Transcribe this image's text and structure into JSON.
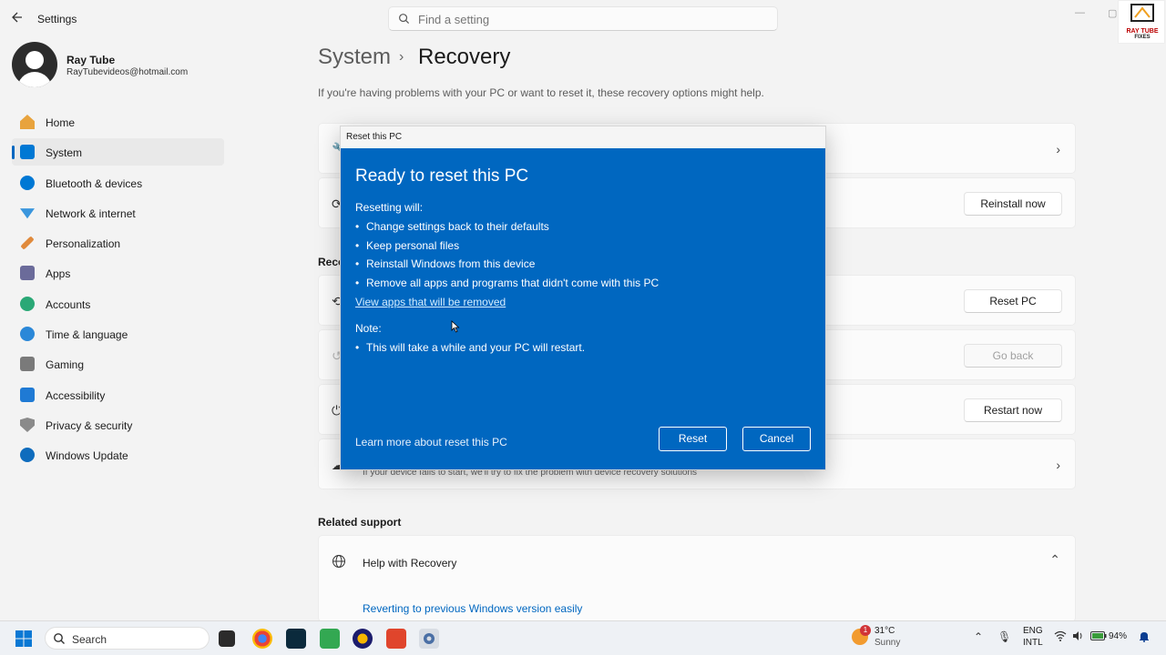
{
  "window": {
    "title": "Settings",
    "search_placeholder": "Find a setting"
  },
  "logo": {
    "line1": "RAY TUBE",
    "line2": "FIXES"
  },
  "profile": {
    "name": "Ray Tube",
    "email": "RayTubevideos@hotmail.com"
  },
  "nav": {
    "items": [
      {
        "label": "Home",
        "icon": "home-icon",
        "color": "#e8a33d"
      },
      {
        "label": "System",
        "icon": "system-icon",
        "color": "#0078d4",
        "active": true
      },
      {
        "label": "Bluetooth & devices",
        "icon": "bluetooth-icon",
        "color": "#0078d4"
      },
      {
        "label": "Network & internet",
        "icon": "network-icon",
        "color": "#3a96dd"
      },
      {
        "label": "Personalization",
        "icon": "brush-icon",
        "color": "#e08a3c"
      },
      {
        "label": "Apps",
        "icon": "apps-icon",
        "color": "#6b6b9a"
      },
      {
        "label": "Accounts",
        "icon": "accounts-icon",
        "color": "#2aa876"
      },
      {
        "label": "Time & language",
        "icon": "time-language-icon",
        "color": "#2b88d8"
      },
      {
        "label": "Gaming",
        "icon": "gaming-icon",
        "color": "#7a7a7a"
      },
      {
        "label": "Accessibility",
        "icon": "accessibility-icon",
        "color": "#1f7ad4"
      },
      {
        "label": "Privacy & security",
        "icon": "shield-icon",
        "color": "#8a8a8a"
      },
      {
        "label": "Windows Update",
        "icon": "update-icon",
        "color": "#0f6cbd"
      }
    ]
  },
  "header": {
    "parent": "System",
    "separator": "›",
    "title": "Recovery"
  },
  "subtitle": "If you're having problems with your PC or want to reset it, these recovery options might help.",
  "cards": {
    "reinstall_button": "Reinstall now",
    "section_label": "Reco",
    "reset_button": "Reset PC",
    "goback_button": "Go back",
    "restart_button": "Restart now",
    "recovery_sub": "If your device fails to start, we'll try to fix the problem with device recovery solutions"
  },
  "related": {
    "label": "Related support",
    "help_title": "Help with Recovery",
    "help_link": "Reverting to previous Windows version easily"
  },
  "dialog": {
    "window_title": "Reset this PC",
    "heading": "Ready to reset this PC",
    "resetting_will": "Resetting will:",
    "bullets": [
      "Change settings back to their defaults",
      "Keep personal files",
      "Reinstall Windows from this device",
      "Remove all apps and programs that didn't come with this PC"
    ],
    "view_apps_link": "View apps that will be removed",
    "note_label": "Note:",
    "note_bullet": "This will take a while and your PC will restart.",
    "learn_more": "Learn more about reset this PC",
    "reset_button": "Reset",
    "cancel_button": "Cancel",
    "bullet_char": "•"
  },
  "taskbar": {
    "search_label": "Search",
    "weather": {
      "badge": "1",
      "temp": "31°C",
      "condition": "Sunny"
    },
    "lang_line1": "ENG",
    "lang_line2": "INTL",
    "battery": "94%"
  },
  "colors": {
    "accent": "#0067c0",
    "dialog_bg": "#0067c0"
  }
}
